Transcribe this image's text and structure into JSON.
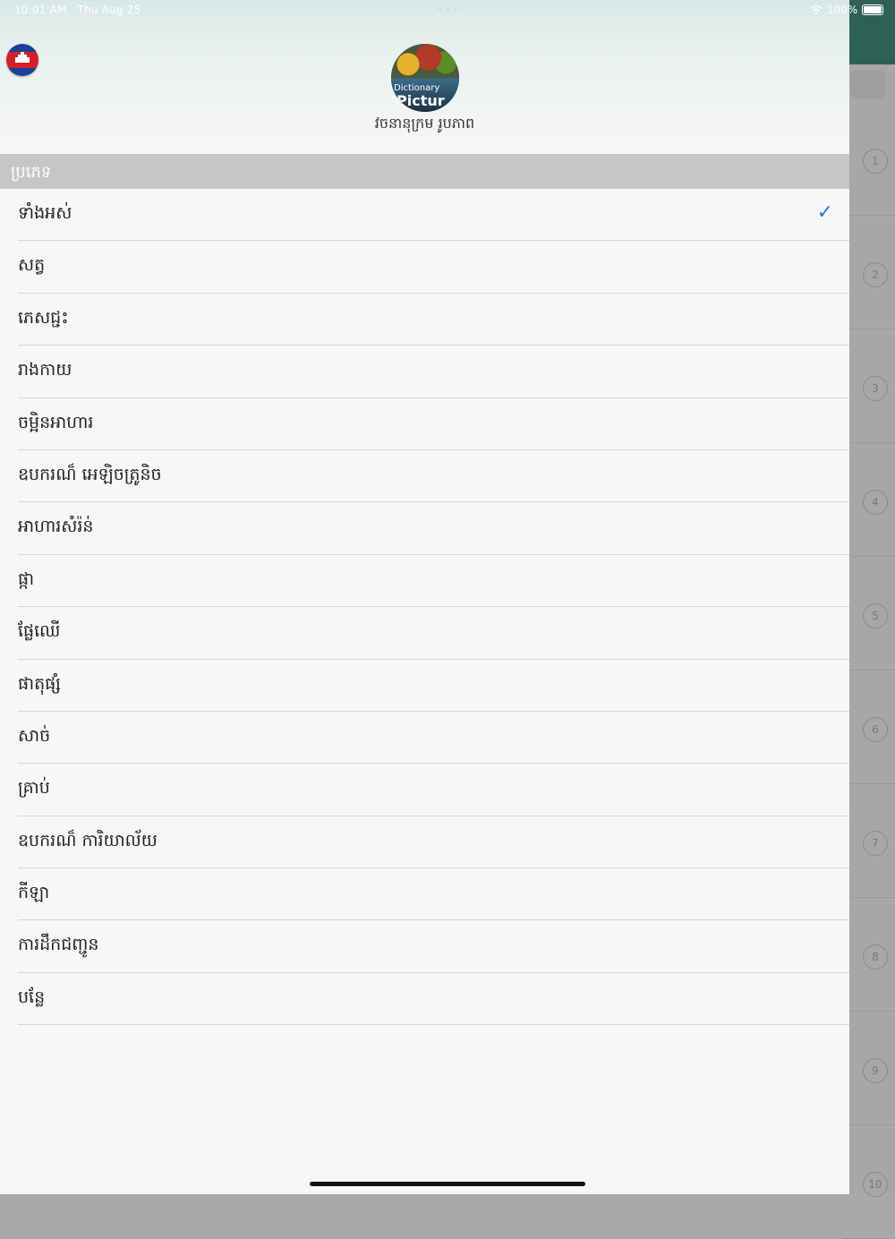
{
  "status_bar": {
    "time": "10:01 AM",
    "date": "Thu Aug 25",
    "battery": "100%"
  },
  "drawer": {
    "app_name": "វចនានុក្រម រូបភាព",
    "logo_text_1": "Dictionary",
    "logo_text_2": "Pictur",
    "section_title": "ប្រភេទ",
    "categories": [
      {
        "label": "ទាំងអស់",
        "selected": true
      },
      {
        "label": "សត្វ",
        "selected": false
      },
      {
        "label": "ភេសជ្ជះ",
        "selected": false
      },
      {
        "label": "រាងកាយ",
        "selected": false
      },
      {
        "label": "ចម្អិនអាហារ",
        "selected": false
      },
      {
        "label": "ឧបករណ៏ អេឡិចត្រូនិច",
        "selected": false
      },
      {
        "label": "អាហារសំរ៉ន់",
        "selected": false
      },
      {
        "label": "ផ្កា",
        "selected": false
      },
      {
        "label": "ផ្លែឈើ",
        "selected": false
      },
      {
        "label": "ផាតុផ្សំ",
        "selected": false
      },
      {
        "label": "សាច់",
        "selected": false
      },
      {
        "label": "គ្រាប់",
        "selected": false
      },
      {
        "label": "ឧបករណ៏ ការិយាល័យ",
        "selected": false
      },
      {
        "label": "កីឡា",
        "selected": false
      },
      {
        "label": "ការដឹកជញ្ជូន",
        "selected": false
      },
      {
        "label": "បន្លែ",
        "selected": false
      }
    ],
    "check_glyph": "✓"
  },
  "background_list": {
    "numbers": [
      "1",
      "2",
      "3",
      "4",
      "5",
      "6",
      "7",
      "8",
      "9",
      "10"
    ]
  },
  "colors": {
    "accent": "#1e7bf0",
    "topbar": "#2f5f55",
    "section_header": "#c6c6c6"
  }
}
